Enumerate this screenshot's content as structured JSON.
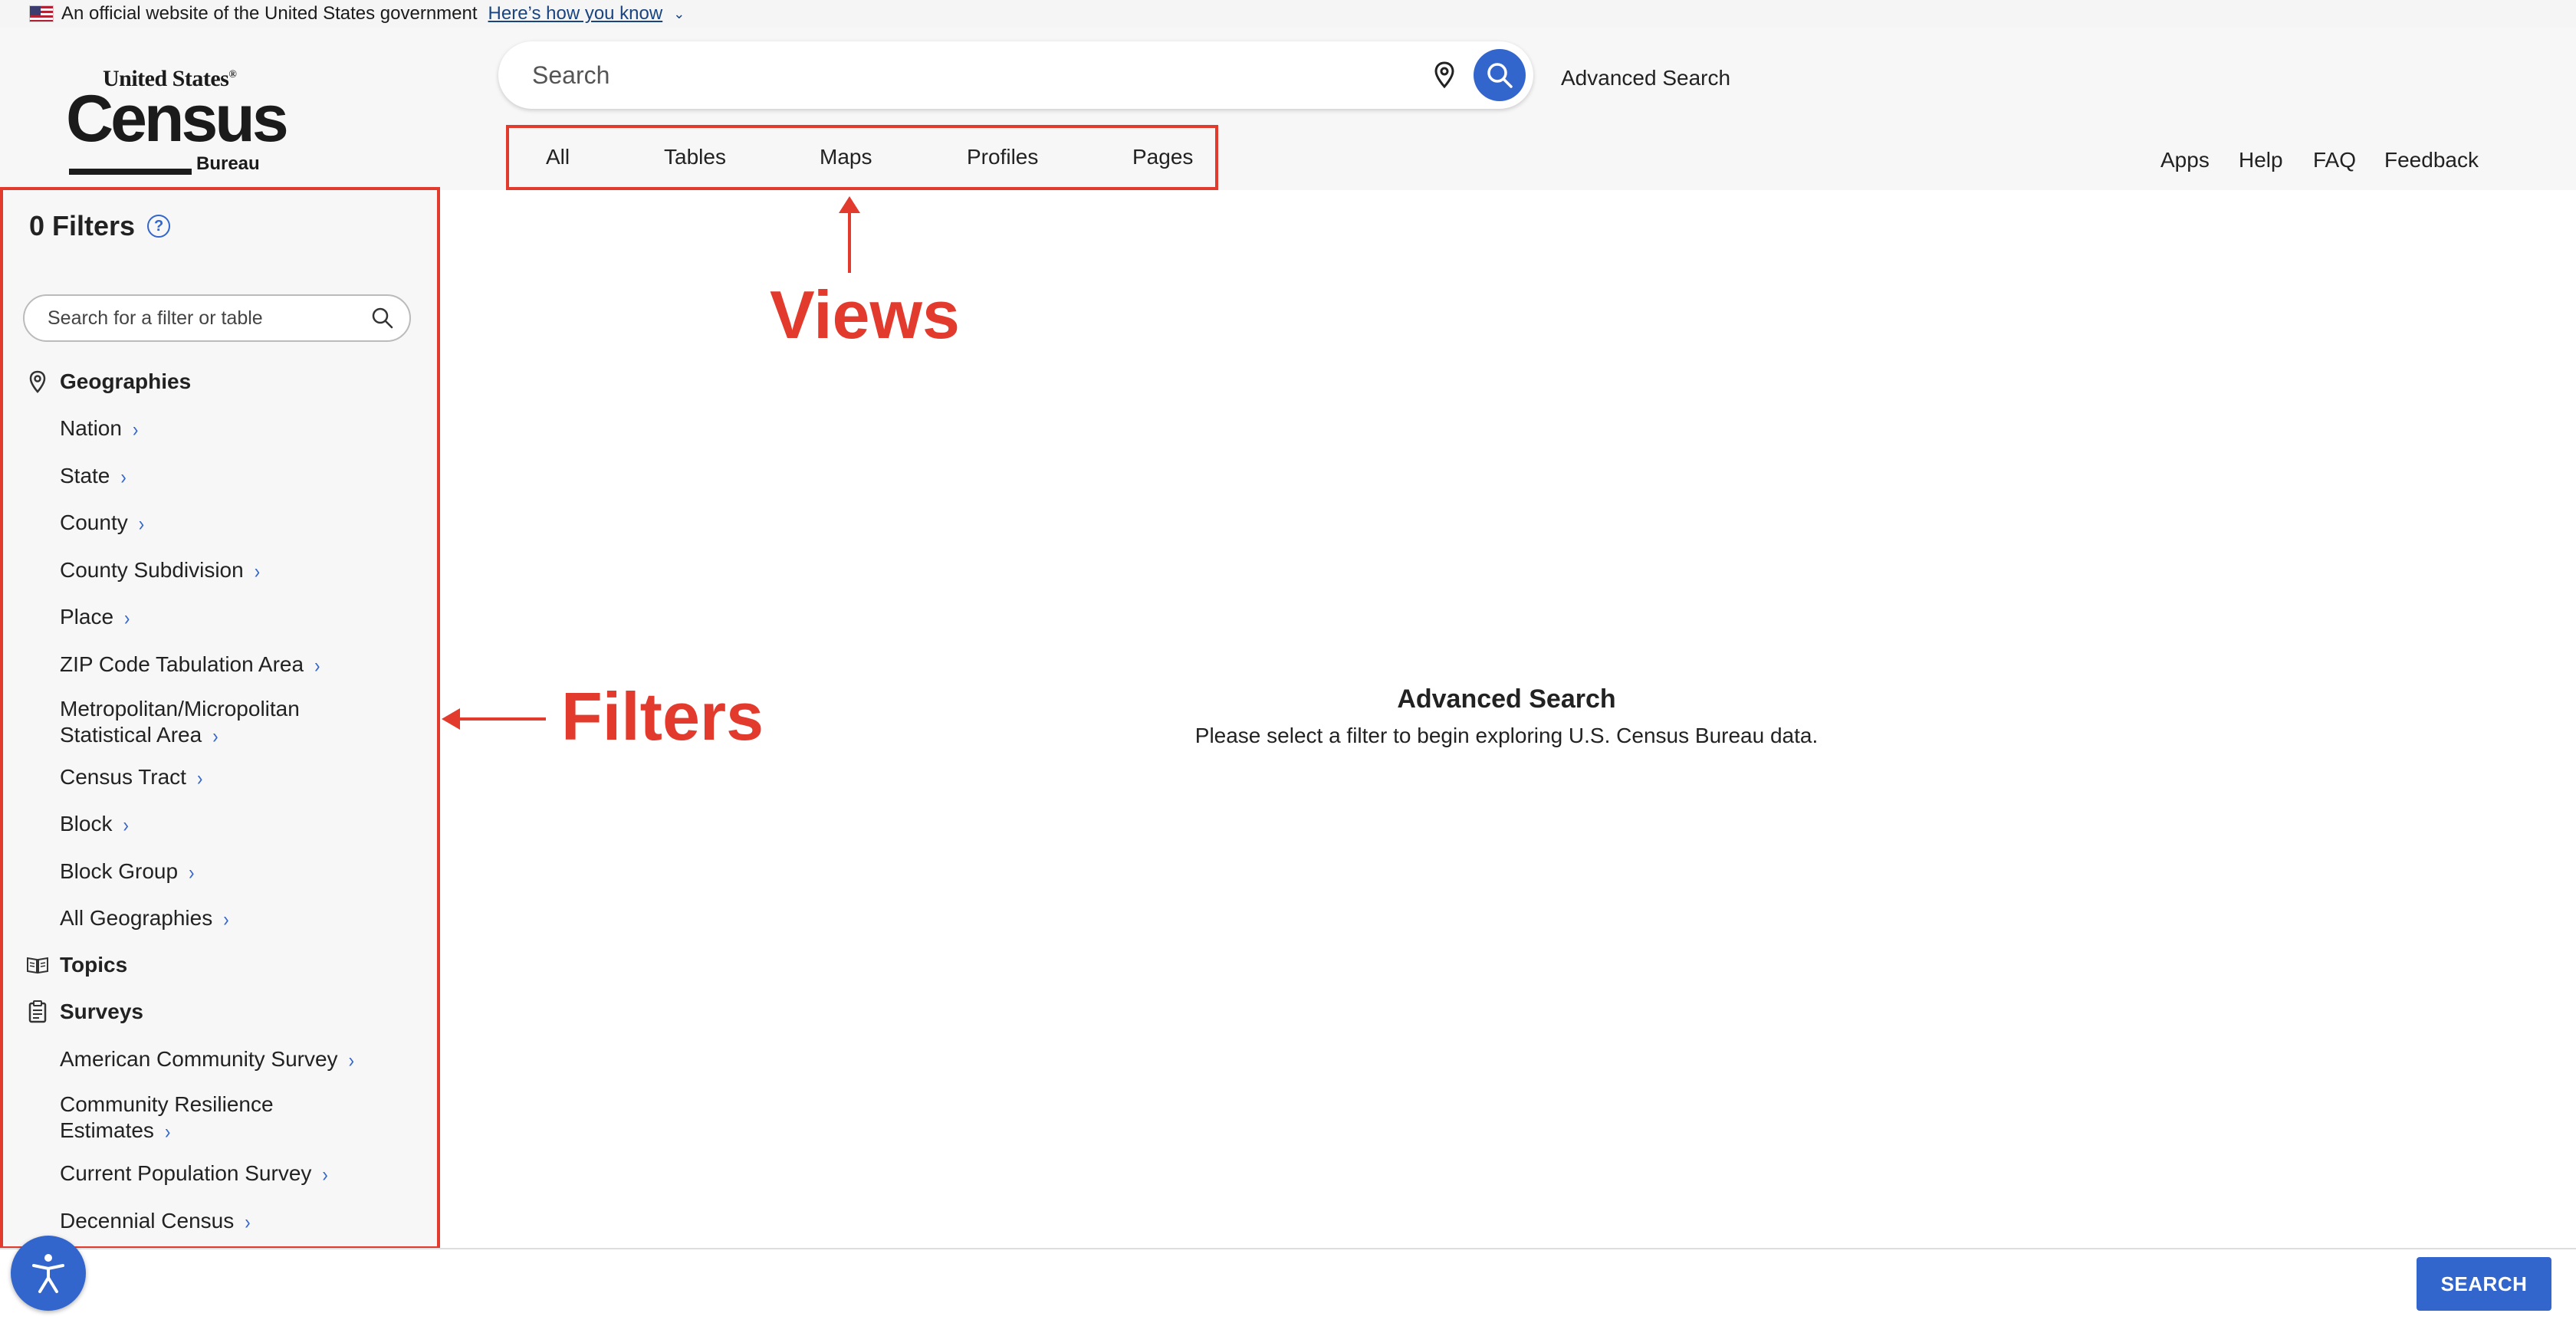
{
  "gov_banner": {
    "text": "An official website of the United States government",
    "link": "Here’s how you know"
  },
  "logo": {
    "line1": "United States",
    "line2": "Census",
    "line3": "Bureau"
  },
  "header": {
    "search_placeholder": "Search",
    "advanced_search": "Advanced Search"
  },
  "views": [
    "All",
    "Tables",
    "Maps",
    "Profiles",
    "Pages"
  ],
  "right_nav": [
    "Apps",
    "Help",
    "FAQ",
    "Feedback"
  ],
  "sidebar": {
    "title": "0 Filters",
    "help": "?",
    "search_placeholder": "Search for a filter or table",
    "geographies": {
      "label": "Geographies",
      "items": [
        "Nation",
        "State",
        "County",
        "County Subdivision",
        "Place",
        "ZIP Code Tabulation Area",
        "Metropolitan/Micropolitan",
        "Statistical Area",
        "Census Tract",
        "Block",
        "Block Group",
        "All Geographies"
      ]
    },
    "topics": {
      "label": "Topics"
    },
    "surveys": {
      "label": "Surveys",
      "items": [
        "American Community Survey",
        "Community Resilience",
        "Estimates",
        "Current Population Survey",
        "Decennial Census"
      ]
    }
  },
  "main": {
    "title": "Advanced Search",
    "subtitle": "Please select a filter to begin exploring U.S. Census Bureau data."
  },
  "annotations": {
    "views": "Views",
    "filters": "Filters"
  },
  "footer": {
    "search_button": "SEARCH"
  },
  "colors": {
    "accent": "#3366cc",
    "annotation": "#e23b2e"
  }
}
